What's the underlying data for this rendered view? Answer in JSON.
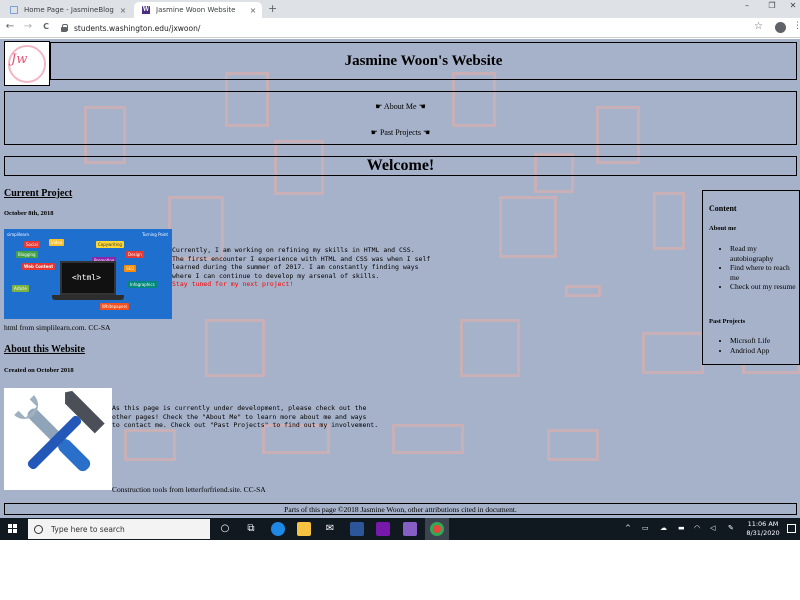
{
  "browser": {
    "tabs": [
      {
        "label": "Home Page - JasmineBlog",
        "active": false
      },
      {
        "label": "Jasmine Woon Website",
        "active": true
      }
    ],
    "tab_close_glyph": "×",
    "new_tab_glyph": "+",
    "window_controls": {
      "minimize": "–",
      "restore": "❐",
      "close": "✕"
    },
    "nav": {
      "back": "←",
      "forward": "→",
      "reload": "C"
    },
    "url": "students.washington.edu/jxwoon/",
    "bookmark_glyph": "☆",
    "menu_glyph": "⋮"
  },
  "page": {
    "logo_text": "Jw",
    "site_title": "Jasmine Woon's Website",
    "nav_links": [
      "☛ About Me ☚",
      "☛ Past Projects ☚"
    ],
    "welcome": "Welcome!",
    "current_project": {
      "heading": "Current Project",
      "date": "October 8th, 2018",
      "text_lines": [
        "Currently, I am working on refining my skills in HTML and CSS.",
        "The first encounter I experience with HTML and CSS was when I self",
        "learned during the summer of 2017. I am constantly finding ways",
        "where I can continue to develop my arsenal of skills."
      ],
      "highlight": "Stay tuned for my next project!",
      "image": {
        "brand": "simplilearn",
        "tag": "Turning Point",
        "chips": [
          "Social",
          "Video",
          "Copywriting",
          "Blogging",
          "Web Content",
          "Design",
          "Promoting",
          "SEO",
          "Article",
          "Infographics",
          "Whitepapers"
        ],
        "screen_code": "<html>"
      },
      "caption": "html from simplilearn.com. CC-SA"
    },
    "about_site": {
      "heading": "About this Website",
      "date": "Created on October 2018",
      "text_lines": [
        "As this page is currently under development, please check out the",
        "other pages! Check the \"About Me\" to learn more about me and ways",
        "to contact me. Check out \"Past Projects\" to find out my involvement."
      ],
      "caption": "Construction tools from letterforfriend.site. CC-SA"
    },
    "sidebar": {
      "title": "Content",
      "about_heading": "About me",
      "about_items": [
        "Read my autobiography",
        "Find where to reach me",
        "Check out my resume"
      ],
      "projects_heading": "Past Projects",
      "project_items": [
        "Micrsoft Life",
        "Andriod App"
      ]
    },
    "footer": "Parts of this page ©2018 Jasmine Woon, other attributions cited in document.",
    "colors": {
      "page_bg": "#a6b2c9",
      "accent_red": "#ff0000",
      "deco": "#d8aeae"
    }
  },
  "taskbar": {
    "search_placeholder": "Type here to search",
    "app_icons": [
      "task-view-icon",
      "edge-icon",
      "file-explorer-icon",
      "mail-icon",
      "word-icon",
      "onenote-icon",
      "visual-studio-icon",
      "chrome-icon"
    ],
    "tray": {
      "chevron": "^"
    },
    "time": "11:06 AM",
    "date": "8/31/2020"
  }
}
